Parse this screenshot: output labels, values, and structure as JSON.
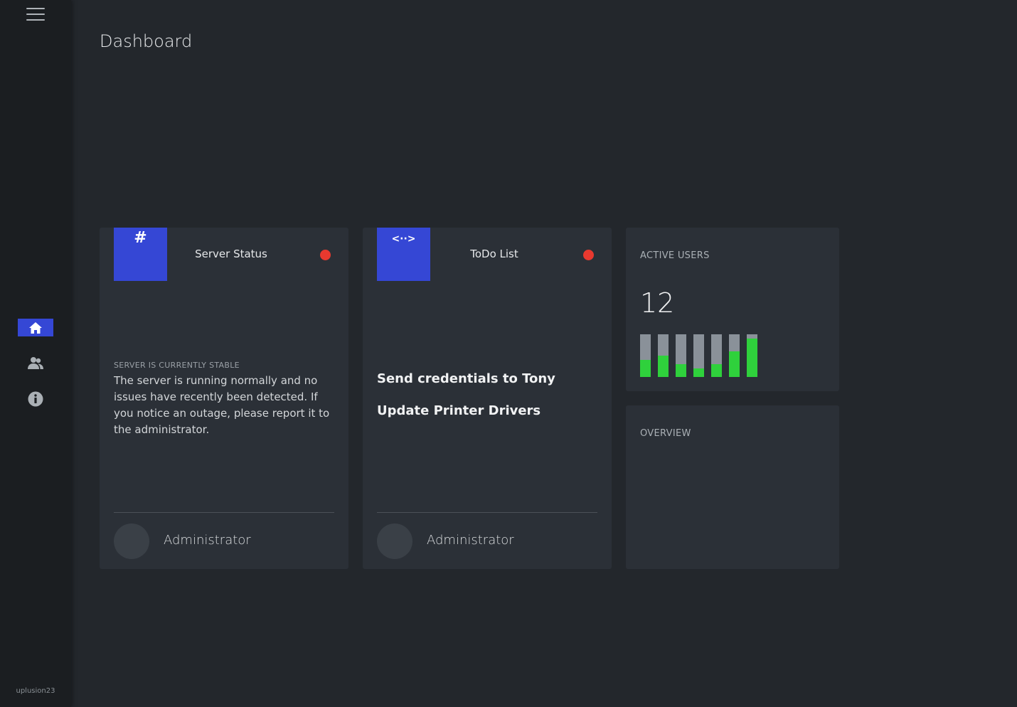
{
  "app": {
    "page_title": "Dashboard",
    "username": "uplusion23"
  },
  "sidebar": {
    "menu_icon": "hamburger-menu-icon",
    "items": [
      {
        "icon": "home-icon",
        "active": true
      },
      {
        "icon": "users-icon",
        "active": false
      },
      {
        "icon": "info-icon",
        "active": false
      }
    ]
  },
  "cards": {
    "server": {
      "icon_glyph": "#",
      "title": "Server Status",
      "status_color": "#e8392f",
      "status_label": "SERVER IS CURRENTLY STABLE",
      "status_text": "The server is running normally and no issues have recently been detected. If you notice an outage, please report it to the administrator.",
      "author": "Administrator"
    },
    "todo": {
      "icon_glyph": "<··>",
      "title": "ToDo List",
      "status_color": "#e8392f",
      "items": [
        "Send credentials to Tony",
        "Update Printer Drivers"
      ],
      "author": "Administrator"
    },
    "active_users": {
      "title": "ACTIVE USERS",
      "value": "12",
      "bar_levels": [
        0.4,
        0.5,
        0.3,
        0.2,
        0.3,
        0.6,
        0.9
      ]
    },
    "overview": {
      "title": "OVERVIEW"
    }
  },
  "colors": {
    "accent": "#3547d5",
    "status_red": "#e8392f",
    "bar_green": "#2fd13c",
    "bar_track": "#8a9199"
  }
}
